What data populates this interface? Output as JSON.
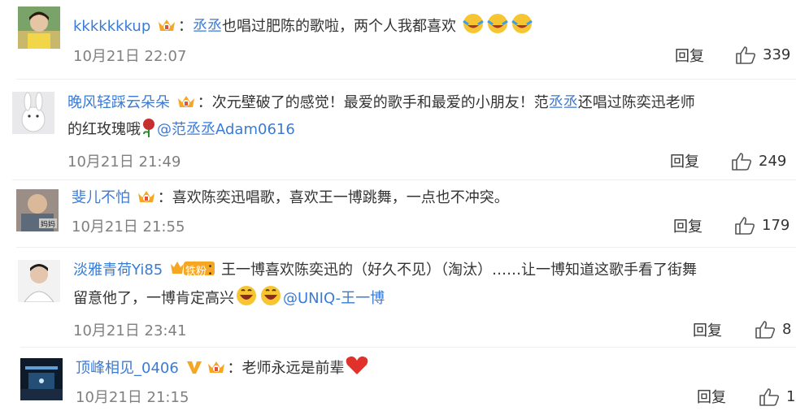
{
  "comments": [
    {
      "user": "kkkkkkkup",
      "before": "：",
      "keyword": "丞丞",
      "after": "也唱过肥陈的歌啦，两个人我都喜欢",
      "time": "10月21日 22:07",
      "reply": "回复",
      "likes": "339"
    },
    {
      "user": "晚风轻踩云朵朵",
      "line1_before": "：次元壁破了的感觉！最爱的歌手和最爱的小朋友！范",
      "line1_kw": "丞丞",
      "line1_after": "还唱过陈奕迅老师",
      "line2": "的红玫瑰哦",
      "mention": "@范丞丞Adam0616",
      "time": "10月21日 21:49",
      "reply": "回复",
      "likes": "249"
    },
    {
      "user": "斐儿不怕",
      "text": "：喜欢陈奕迅唱歌，喜欢王一博跳舞，一点也不冲突。",
      "time": "10月21日 21:55",
      "reply": "回复",
      "likes": "179"
    },
    {
      "user": "淡雅青荷Yi85",
      "fan_badge": "铁粉",
      "line1": "：王一博喜欢陈奕迅的（好久不见）（淘汰）……让一博知道这歌手看了街舞",
      "line2": "留意他了，一博肯定高兴",
      "mention": "@UNIQ-王一博",
      "time": "10月21日 23:41",
      "reply": "回复",
      "likes": "8"
    },
    {
      "user": "顶峰相见_0406",
      "text": "：老师永远是前辈",
      "time": "10月21日 21:15",
      "reply": "回复",
      "likes": "1"
    }
  ],
  "colors": {
    "username": "#3a7bd5",
    "meta": "#808080",
    "text": "#333333",
    "verified_gold": "#f5a623"
  }
}
